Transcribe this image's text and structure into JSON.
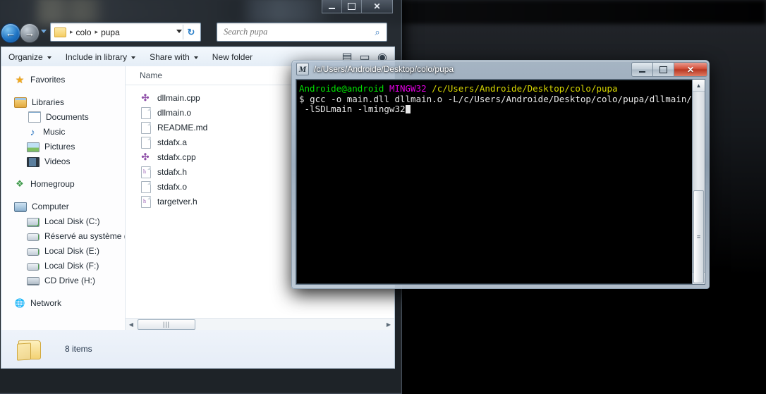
{
  "explorer": {
    "window_controls": {
      "minimize": "—",
      "maximize": "▫",
      "close": "✕"
    },
    "address": {
      "crumb_root": "colo",
      "crumb_leaf": "pupa",
      "separator": "▸",
      "dropdown_icon": "chevron-down-icon",
      "refresh_icon": "↻"
    },
    "search": {
      "placeholder": "Search pupa",
      "value": "",
      "icon": "search-icon"
    },
    "toolbar": {
      "organize": "Organize",
      "include_in_library": "Include in library",
      "share_with": "Share with",
      "new_folder": "New folder"
    },
    "nav_pane": {
      "groups": [
        {
          "items": [
            {
              "label": "Favorites",
              "icon": "star-icon",
              "level": 0
            }
          ]
        },
        {
          "items": [
            {
              "label": "Libraries",
              "icon": "libraries-icon",
              "level": 0
            },
            {
              "label": "Documents",
              "icon": "document-icon",
              "level": 1
            },
            {
              "label": "Music",
              "icon": "music-icon",
              "level": 1
            },
            {
              "label": "Pictures",
              "icon": "picture-icon",
              "level": 1
            },
            {
              "label": "Videos",
              "icon": "video-icon",
              "level": 1
            }
          ]
        },
        {
          "items": [
            {
              "label": "Homegroup",
              "icon": "homegroup-icon",
              "level": 0
            }
          ]
        },
        {
          "items": [
            {
              "label": "Computer",
              "icon": "computer-icon",
              "level": 0
            },
            {
              "label": "Local Disk (C:)",
              "icon": "windows-drive-icon",
              "level": 1
            },
            {
              "label": "Réservé au système (",
              "icon": "drive-icon",
              "level": 1
            },
            {
              "label": "Local Disk (E:)",
              "icon": "drive-icon",
              "level": 1
            },
            {
              "label": "Local Disk (F:)",
              "icon": "drive-icon",
              "level": 1
            },
            {
              "label": "CD Drive (H:)",
              "icon": "cd-drive-icon",
              "level": 1
            }
          ]
        },
        {
          "items": [
            {
              "label": "Network",
              "icon": "network-icon",
              "level": 0
            }
          ]
        }
      ]
    },
    "file_list": {
      "column_header": "Name",
      "files": [
        {
          "name": "dllmain.cpp",
          "icon": "cpp-file-icon"
        },
        {
          "name": "dllmain.o",
          "icon": "generic-file-icon"
        },
        {
          "name": "README.md",
          "icon": "generic-file-icon"
        },
        {
          "name": "stdafx.a",
          "icon": "generic-file-icon"
        },
        {
          "name": "stdafx.cpp",
          "icon": "cpp-file-icon"
        },
        {
          "name": "stdafx.h",
          "icon": "header-file-icon"
        },
        {
          "name": "stdafx.o",
          "icon": "generic-file-icon"
        },
        {
          "name": "targetver.h",
          "icon": "header-file-icon"
        }
      ]
    },
    "status_bar": {
      "item_count": "8 items"
    }
  },
  "terminal": {
    "title": "/c/Users/Androide/Desktop/colo/pupa",
    "icon_letter": "M",
    "window_controls": {
      "minimize": "—",
      "maximize": "▫",
      "close": "✕"
    },
    "prompt": {
      "user_host": "Androide@android",
      "shell": "MINGW32",
      "cwd": "/c/Users/Androide/Desktop/colo/pupa"
    },
    "command_prefix": "$ ",
    "command_line_1": "gcc -o main.dll dllmain.o -L/c/Users/Androide/Desktop/colo/pupa/dllmain/ -lSDL",
    "command_line_2": " -lSDLmain -lmingw32",
    "colors": {
      "user_host": "#00e000",
      "shell": "#e000e0",
      "cwd": "#d7d700",
      "text": "#e8e8e8",
      "background": "#000000"
    }
  }
}
